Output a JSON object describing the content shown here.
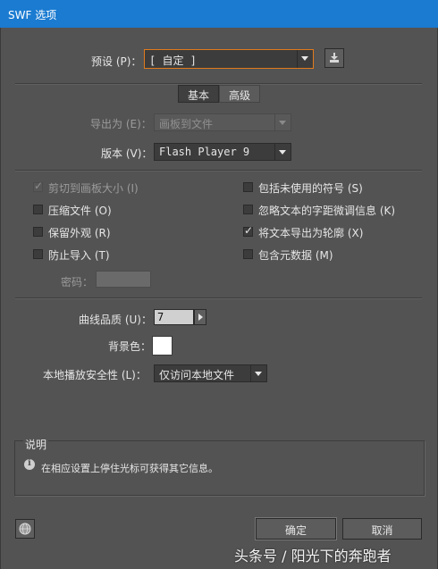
{
  "window": {
    "title": "SWF 选项"
  },
  "preset": {
    "label": "预设 (P)：",
    "value": "[ 自定 ]"
  },
  "tabs": [
    {
      "label": "基本"
    },
    {
      "label": "高级"
    }
  ],
  "export_as": {
    "label": "导出为 (E)：",
    "value": "画板到文件"
  },
  "version": {
    "label": "版本 (V)：",
    "value": "Flash Player 9"
  },
  "checkboxes": {
    "clip_artboard": {
      "label": "剪切到画板大小 (I)",
      "checked": true,
      "disabled": true
    },
    "compress": {
      "label": "压缩文件 (O)",
      "checked": false
    },
    "preserve_appearance": {
      "label": "保留外观 (R)",
      "checked": false
    },
    "protect_import": {
      "label": "防止导入 (T)",
      "checked": false
    },
    "include_unused_symbols": {
      "label": "包括未使用的符号 (S)",
      "checked": false
    },
    "ignore_kerning": {
      "label": "忽略文本的字距微调信息 (K)",
      "checked": false
    },
    "text_to_outlines": {
      "label": "将文本导出为轮廓 (X)",
      "checked": true
    },
    "include_metadata": {
      "label": "包含元数据 (M)",
      "checked": false
    }
  },
  "password": {
    "label": "密码："
  },
  "curve_quality": {
    "label": "曲线品质 (U)：",
    "value": "7"
  },
  "background": {
    "label": "背景色：",
    "color": "#ffffff"
  },
  "local_playback": {
    "label": "本地播放安全性 (L)：",
    "value": "仅访问本地文件"
  },
  "description": {
    "title": "说明",
    "text": "在相应设置上停住光标可获得其它信息。"
  },
  "buttons": {
    "ok": "确定",
    "cancel": "取消"
  },
  "watermark": "头条号 / 阳光下的奔跑者"
}
